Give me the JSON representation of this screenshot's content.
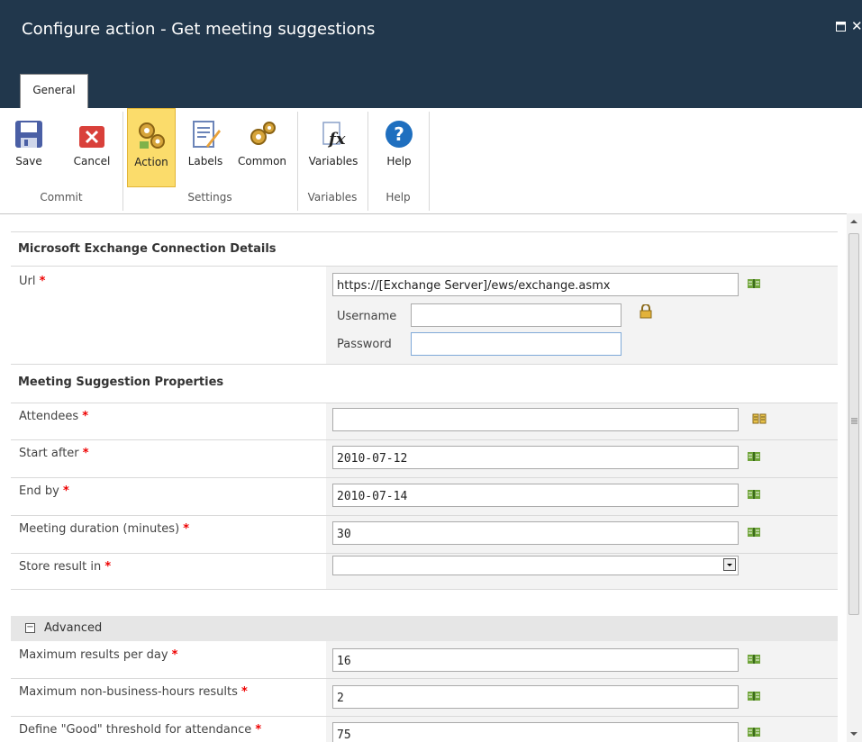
{
  "window": {
    "title": "Configure action - Get meeting suggestions",
    "maximize_icon": "maximize-icon",
    "close_icon": "close-icon"
  },
  "ribbon": {
    "tab": "General",
    "buttons": {
      "save": "Save",
      "cancel": "Cancel",
      "action": "Action",
      "labels": "Labels",
      "common": "Common",
      "variables": "Variables",
      "help": "Help"
    },
    "groups": {
      "commit": "Commit",
      "settings": "Settings",
      "variables": "Variables",
      "help": "Help"
    }
  },
  "connection": {
    "heading": "Microsoft Exchange Connection Details",
    "url_label": "Url",
    "url_value": "https://[Exchange Server]/ews/exchange.asmx",
    "username_label": "Username",
    "username_value": "",
    "password_label": "Password",
    "password_value": ""
  },
  "meeting": {
    "heading": "Meeting Suggestion Properties",
    "attendees_label": "Attendees",
    "attendees_value": "",
    "start_label": "Start after",
    "start_value": "2010-07-12",
    "end_label": "End by",
    "end_value": "2010-07-14",
    "duration_label": "Meeting duration (minutes)",
    "duration_value": "30",
    "store_label": "Store result in",
    "store_value": ""
  },
  "advanced": {
    "heading": "Advanced",
    "max_per_day_label": "Maximum results per day",
    "max_per_day_value": "16",
    "max_nonbiz_label": "Maximum non-business-hours results",
    "max_nonbiz_value": "2",
    "good_label": "Define \"Good\" threshold for attendance",
    "good_value": "75"
  },
  "required_marker": "*",
  "colors": {
    "titlebar": "#21374c",
    "selected_button": "#fbdc6b",
    "required": "#ee0000"
  }
}
